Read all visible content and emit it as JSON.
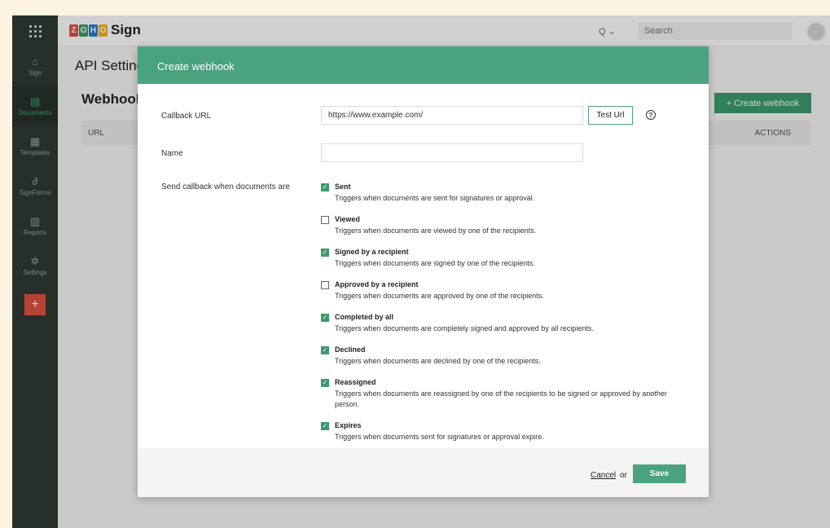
{
  "brand": {
    "logo_letters": [
      "Z",
      "O",
      "H",
      "O"
    ],
    "name": "Sign"
  },
  "topbar": {
    "search_scope": "Q ⌄",
    "search_placeholder": "Search"
  },
  "sidebar": {
    "items": [
      {
        "label": "Sign",
        "icon": "⌂"
      },
      {
        "label": "Documents",
        "icon": "▤"
      },
      {
        "label": "Templates",
        "icon": "▦"
      },
      {
        "label": "SignForms",
        "icon": "∂"
      },
      {
        "label": "Reports",
        "icon": "▥"
      },
      {
        "label": "Settings",
        "icon": "✲"
      }
    ],
    "add_label": "+"
  },
  "page": {
    "title": "API Settings",
    "section": "Webhooks",
    "create_button": "+ Create webhook",
    "table_headers": [
      "URL",
      "ACTIONS"
    ]
  },
  "modal": {
    "title": "Create webhook",
    "callback_label": "Callback URL",
    "callback_value": "https://www.example.com/",
    "test_button": "Test Url",
    "help_glyph": "?",
    "name_label": "Name",
    "name_value": "",
    "send_label": "Send callback when documents are",
    "events": [
      {
        "title": "Sent",
        "desc": "Triggers when documents are sent for signatures or approval.",
        "checked": true
      },
      {
        "title": "Viewed",
        "desc": "Triggers when documents are viewed by one of the recipients.",
        "checked": false
      },
      {
        "title": "Signed by a recipient",
        "desc": "Triggers when documents are signed by one of the recipients.",
        "checked": true
      },
      {
        "title": "Approved by a recipient",
        "desc": "Triggers when documents are approved by one of the recipients.",
        "checked": false
      },
      {
        "title": "Completed by all",
        "desc": "Triggers when documents are completely signed and approved by all recipients.",
        "checked": true
      },
      {
        "title": "Declined",
        "desc": "Triggers when documents are declined by one of the recipients.",
        "checked": true
      },
      {
        "title": "Reassigned",
        "desc": "Triggers when documents are reassigned by one of the recipients to be signed or approved by another person.",
        "checked": true
      },
      {
        "title": "Expires",
        "desc": "Triggers when documents sent for signatures or approval expire.",
        "checked": true
      }
    ],
    "cancel_label": "Cancel",
    "or_label": "or",
    "save_label": "Save"
  },
  "colors": {
    "accent": "#4aa37f",
    "sidebar": "#2f3a33",
    "add": "#e0523f"
  }
}
